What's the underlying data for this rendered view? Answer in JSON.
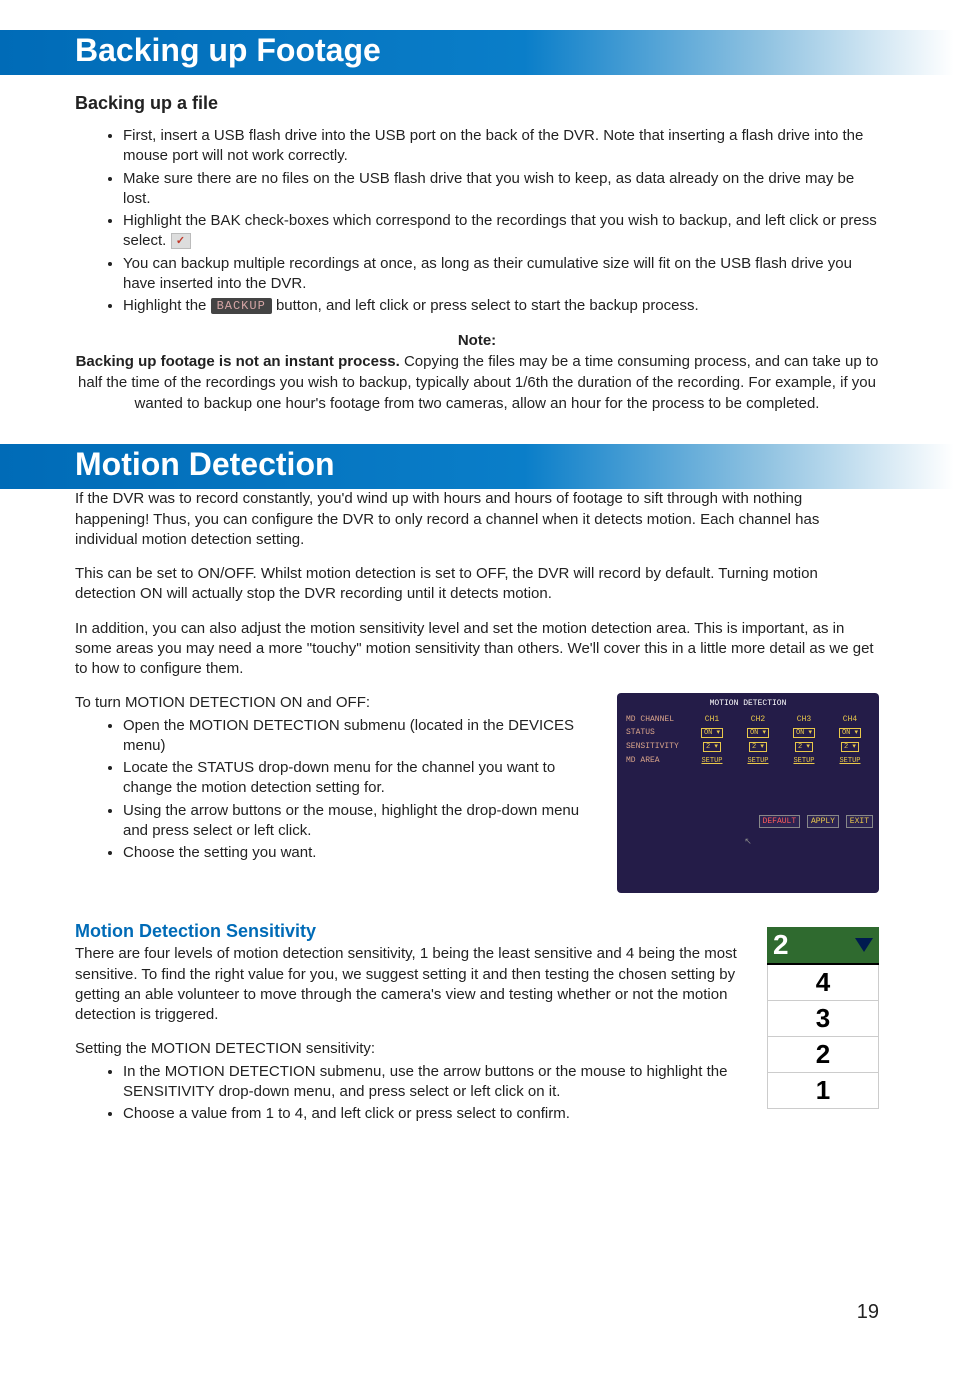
{
  "header1": "Backing up Footage",
  "sub1": "Backing up a file",
  "backup_bullets": [
    "First, insert a USB flash drive into the USB port on the back of the DVR. Note that inserting a flash drive into the mouse port will not work correctly.",
    "Make sure there are no files on the USB flash drive that you wish to keep, as data already on the drive may be lost.",
    "Highlight the BAK check-boxes which correspond to the recordings that you wish to backup, and left click or press select.",
    "You can backup multiple recordings at once, as long as their cumulative size will fit on the USB flash drive you have inserted into the DVR.",
    "Highlight the "
  ],
  "backup_bullet_5_tail": " button, and left click or press select to start the backup process.",
  "backup_btn_label": "BACKUP",
  "note_label": "Note:",
  "note_strong": "Backing up footage is not an instant process.",
  "note_body": " Copying the files may be a time consuming process, and can take up to half the time of the recordings you wish to backup, typically about 1/6th the duration of the recording. For example, if you wanted to backup one hour's footage from two cameras, allow an hour for the process to be completed.",
  "header2": "Motion Detection",
  "md_p1": "If the DVR was to record constantly, you'd wind up with hours and hours of footage to sift through with nothing happening! Thus, you can configure the DVR to only record a channel when it detects motion. Each channel has individual motion detection setting.",
  "md_p2": "This can be set to ON/OFF. Whilst motion detection is set to OFF, the DVR will record by default. Turning motion detection ON will actually stop the DVR recording until it detects motion.",
  "md_p3": "In addition, you can also adjust the motion sensitivity level and set the motion detection area. This is important, as in some areas you may need a more \"touchy\" motion sensitivity than others. We'll cover this in a little more detail as we get to how to configure them.",
  "md_p4": "To turn MOTION DETECTION ON and OFF:",
  "md_steps": [
    "Open the MOTION DETECTION submenu (located in the DEVICES menu)",
    "Locate the STATUS drop-down menu for the channel you want to change the motion detection setting for.",
    "Using the arrow buttons or the mouse, highlight the drop-down menu and press select or left click.",
    "Choose the setting you want."
  ],
  "mds_head": "Motion Detection Sensitivity",
  "mds_p1": "There are four levels of motion detection sensitivity, 1 being the least sensitive and 4 being the most sensitive. To find the right value for you, we suggest setting it and then testing the chosen setting by getting an able volunteer to move through the camera's view and testing whether or not the motion detection is triggered.",
  "mds_p2": "Setting the MOTION DETECTION sensitivity:",
  "mds_steps": [
    "In the MOTION DETECTION submenu, use the arrow buttons or the mouse to highlight the SENSITIVITY drop-down menu, and press select or left click on it.",
    "Choose a value from 1 to 4, and left click or press select to confirm."
  ],
  "md_screenshot": {
    "title": "MOTION DETECTION",
    "rows": {
      "channel_label": "MD CHANNEL",
      "channels": [
        "CH1",
        "CH2",
        "CH3",
        "CH4"
      ],
      "status_label": "STATUS",
      "status_values": [
        "ON",
        "ON",
        "ON",
        "ON"
      ],
      "sens_label": "SENSITIVITY",
      "sens_values": [
        "2",
        "2",
        "2",
        "2"
      ],
      "area_label": "MD AREA",
      "area_values": [
        "SETUP",
        "SETUP",
        "SETUP",
        "SETUP"
      ]
    },
    "buttons": [
      "DEFAULT",
      "APPLY",
      "EXIT"
    ]
  },
  "sens_figure": {
    "selected": "2",
    "options": [
      "4",
      "3",
      "2",
      "1"
    ]
  },
  "page_number": "19"
}
